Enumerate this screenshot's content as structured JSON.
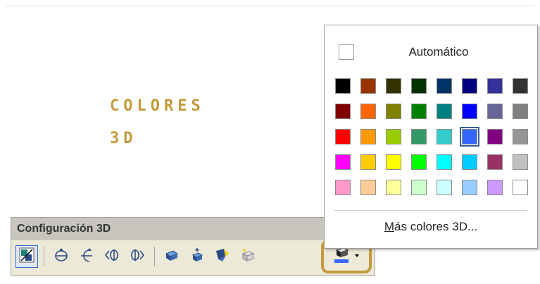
{
  "wordart": {
    "line1": "COLORES",
    "line2": "3D"
  },
  "toolbar": {
    "title": "Configuración 3D",
    "buttons": [
      {
        "name": "toggle-3d-button",
        "icon": "toggle-3d-icon"
      },
      {
        "name": "tilt-down-button",
        "icon": "tilt-down-icon"
      },
      {
        "name": "tilt-up-button",
        "icon": "tilt-up-icon"
      },
      {
        "name": "tilt-left-button",
        "icon": "tilt-left-icon"
      },
      {
        "name": "tilt-right-button",
        "icon": "tilt-right-icon"
      },
      {
        "name": "depth-button",
        "icon": "depth-icon"
      },
      {
        "name": "direction-button",
        "icon": "direction-icon"
      },
      {
        "name": "lighting-button",
        "icon": "lighting-icon"
      },
      {
        "name": "surface-button",
        "icon": "surface-icon"
      },
      {
        "name": "3d-color-button",
        "icon": "3d-color-icon"
      }
    ]
  },
  "dropdown": {
    "automatic_label": "Automático",
    "more_colors_mnemonic": "M",
    "more_colors_rest": "ás colores 3D...",
    "selected_index": 21,
    "colors": [
      "#000000",
      "#993300",
      "#333300",
      "#003300",
      "#003366",
      "#000080",
      "#333399",
      "#333333",
      "#800000",
      "#ff6600",
      "#808000",
      "#008000",
      "#008080",
      "#0000ff",
      "#666699",
      "#808080",
      "#ff0000",
      "#ff9900",
      "#99cc00",
      "#339966",
      "#33cccc",
      "#3366ff",
      "#800080",
      "#969696",
      "#ff00ff",
      "#ffcc00",
      "#ffff00",
      "#00ff00",
      "#00ffff",
      "#00ccff",
      "#993366",
      "#c0c0c0",
      "#ff99cc",
      "#ffcc99",
      "#ffff99",
      "#ccffcc",
      "#ccffff",
      "#99ccff",
      "#cc99ff",
      "#ffffff"
    ]
  },
  "accent": "#c49a3c"
}
